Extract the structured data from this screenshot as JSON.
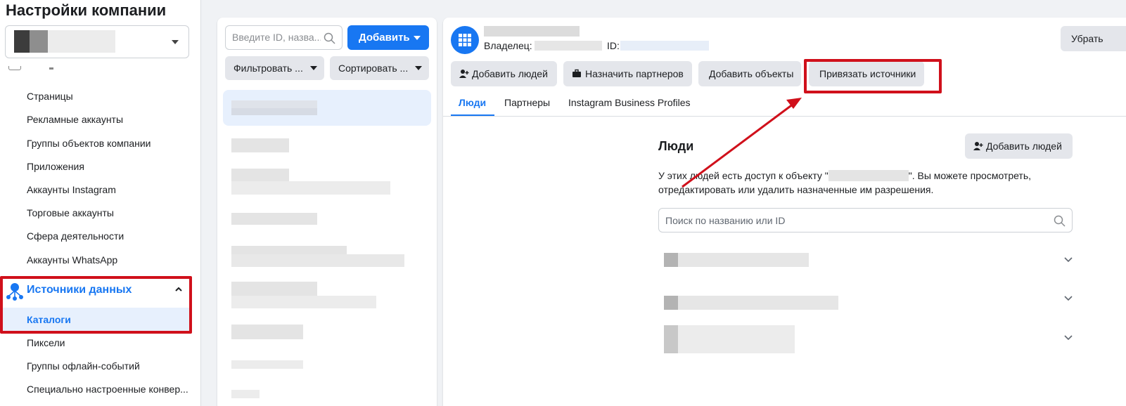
{
  "sidebar": {
    "title": "Настройки компании",
    "items": [
      "Страницы",
      "Рекламные аккаунты",
      "Группы объектов компании",
      "Приложения",
      "Аккаунты Instagram",
      "Торговые аккаунты",
      "Сфера деятельности",
      "Аккаунты WhatsApp"
    ],
    "section": "Источники данных",
    "active_item": "Каталоги",
    "sub_items": [
      "Пиксели",
      "Группы офлайн-событий",
      "Специально настроенные конвер..."
    ]
  },
  "list": {
    "search_placeholder": "Введите ID, назва...",
    "add_label": "Добавить",
    "filter_label": "Фильтровать ...",
    "sort_label": "Сортировать ..."
  },
  "detail": {
    "owner_label": "Владелец:",
    "id_label": "ID:",
    "remove_label": "Убрать",
    "actions": {
      "add_people": "Добавить людей",
      "assign_partners": "Назначить партнеров",
      "add_assets": "Добавить объекты",
      "link_sources": "Привязать источники"
    },
    "tabs": [
      "Люди",
      "Партнеры",
      "Instagram Business Profiles"
    ],
    "people": {
      "title": "Люди",
      "add_label": "Добавить людей",
      "desc_before": "У этих людей есть доступ к объекту \"",
      "desc_after": "\". Вы можете просмотреть, отредактировать или удалить назначенные им разрешения.",
      "search_placeholder": "Поиск по названию или ID"
    }
  },
  "colors": {
    "accent": "#1877f2",
    "highlight": "#d0101b"
  }
}
